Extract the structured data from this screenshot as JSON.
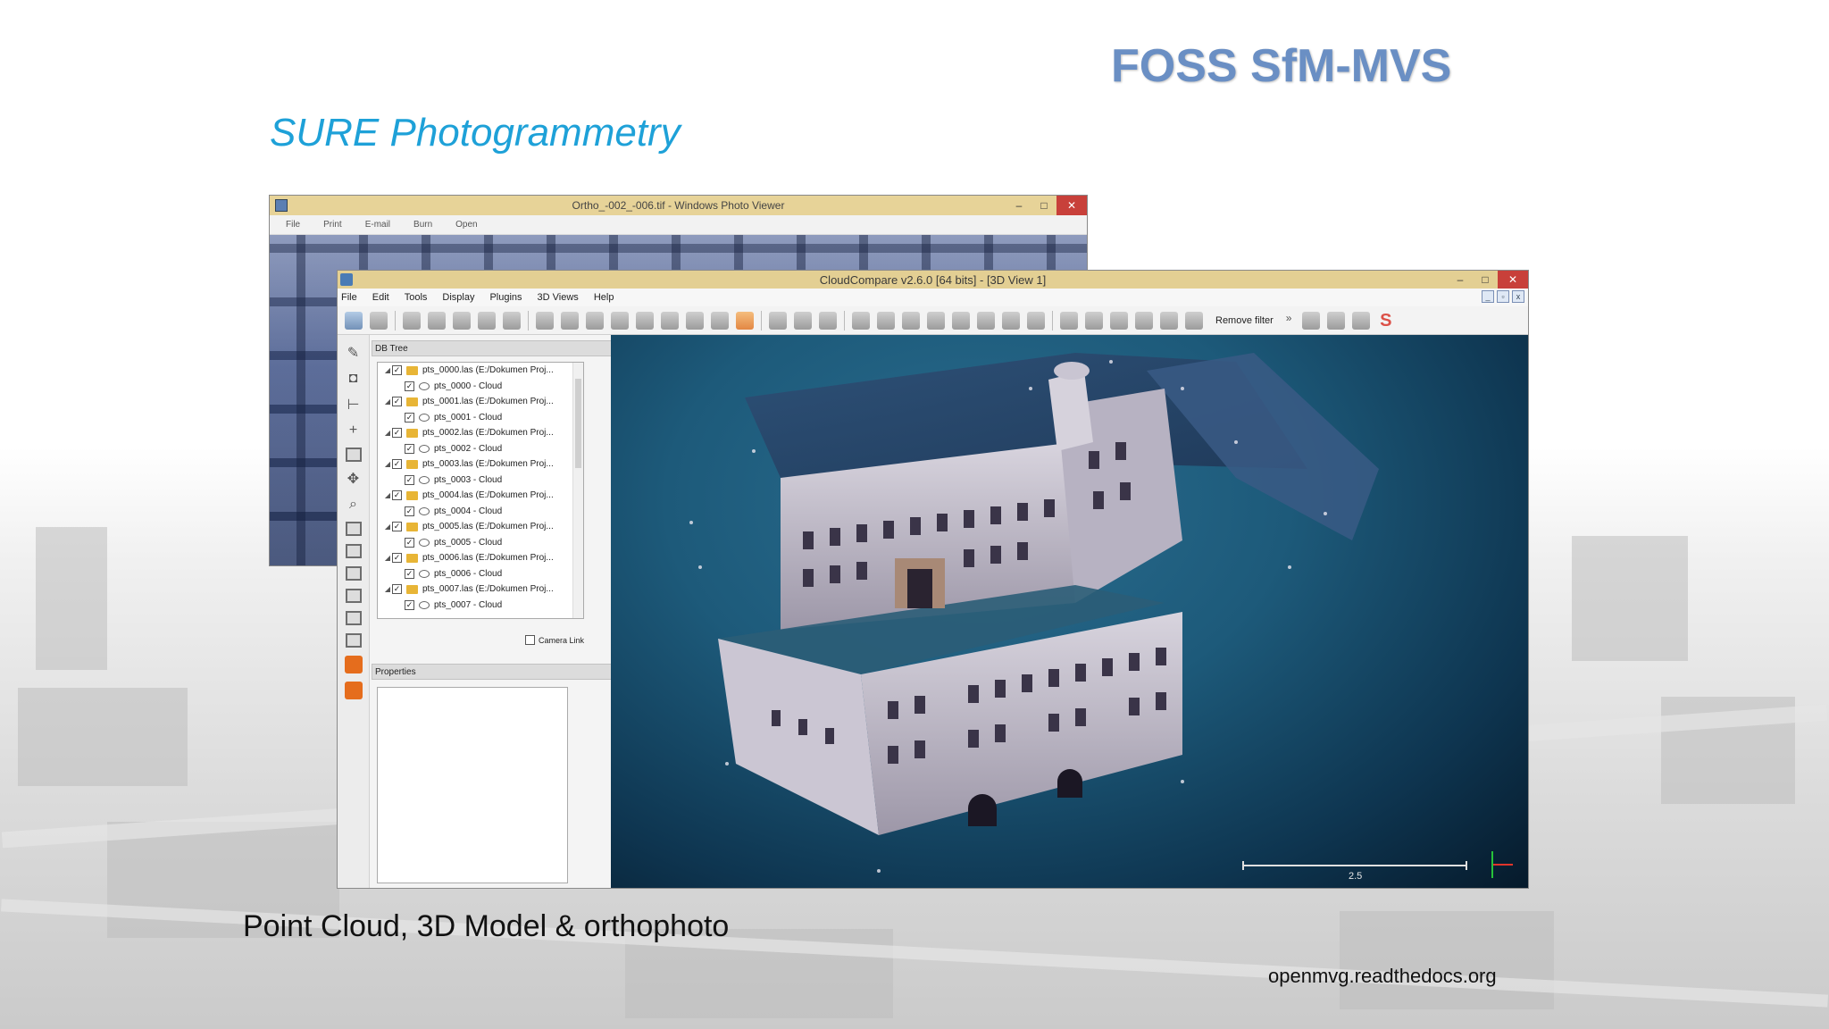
{
  "slide": {
    "title": "FOSS SfM-MVS",
    "subtitle": "SURE Photogrammetry",
    "caption": "Point Cloud, 3D Model & orthophoto",
    "source": "openmvg.readthedocs.org"
  },
  "photo_viewer": {
    "title": "Ortho_-002_-006.tif - Windows Photo Viewer",
    "menu": [
      "File",
      "Print",
      "E-mail",
      "Burn",
      "Open"
    ]
  },
  "cloudcompare": {
    "title": "CloudCompare v2.6.0 [64 bits] - [3D View 1]",
    "menu": [
      "File",
      "Edit",
      "Tools",
      "Display",
      "Plugins",
      "3D Views",
      "Help"
    ],
    "toolbar_text": "Remove filter",
    "db_tree_label": "DB Tree",
    "properties_label": "Properties",
    "camera_link_label": "Camera Link",
    "tree": [
      {
        "label": "pts_0000.las (E:/Dokumen Proj...",
        "child": "pts_0000 - Cloud"
      },
      {
        "label": "pts_0001.las (E:/Dokumen Proj...",
        "child": "pts_0001 - Cloud"
      },
      {
        "label": "pts_0002.las (E:/Dokumen Proj...",
        "child": "pts_0002 - Cloud"
      },
      {
        "label": "pts_0003.las (E:/Dokumen Proj...",
        "child": "pts_0003 - Cloud"
      },
      {
        "label": "pts_0004.las (E:/Dokumen Proj...",
        "child": "pts_0004 - Cloud"
      },
      {
        "label": "pts_0005.las (E:/Dokumen Proj...",
        "child": "pts_0005 - Cloud"
      },
      {
        "label": "pts_0006.las (E:/Dokumen Proj...",
        "child": "pts_0006 - Cloud"
      },
      {
        "label": "pts_0007.las (E:/Dokumen Proj...",
        "child": "pts_0007 - Cloud"
      }
    ],
    "scale_value": "2.5"
  },
  "colors": {
    "title": "#6a8fc4",
    "subtitle": "#1ea1d8",
    "titlebar": "#e3cf93",
    "view_bg": "#1d5a7a"
  }
}
